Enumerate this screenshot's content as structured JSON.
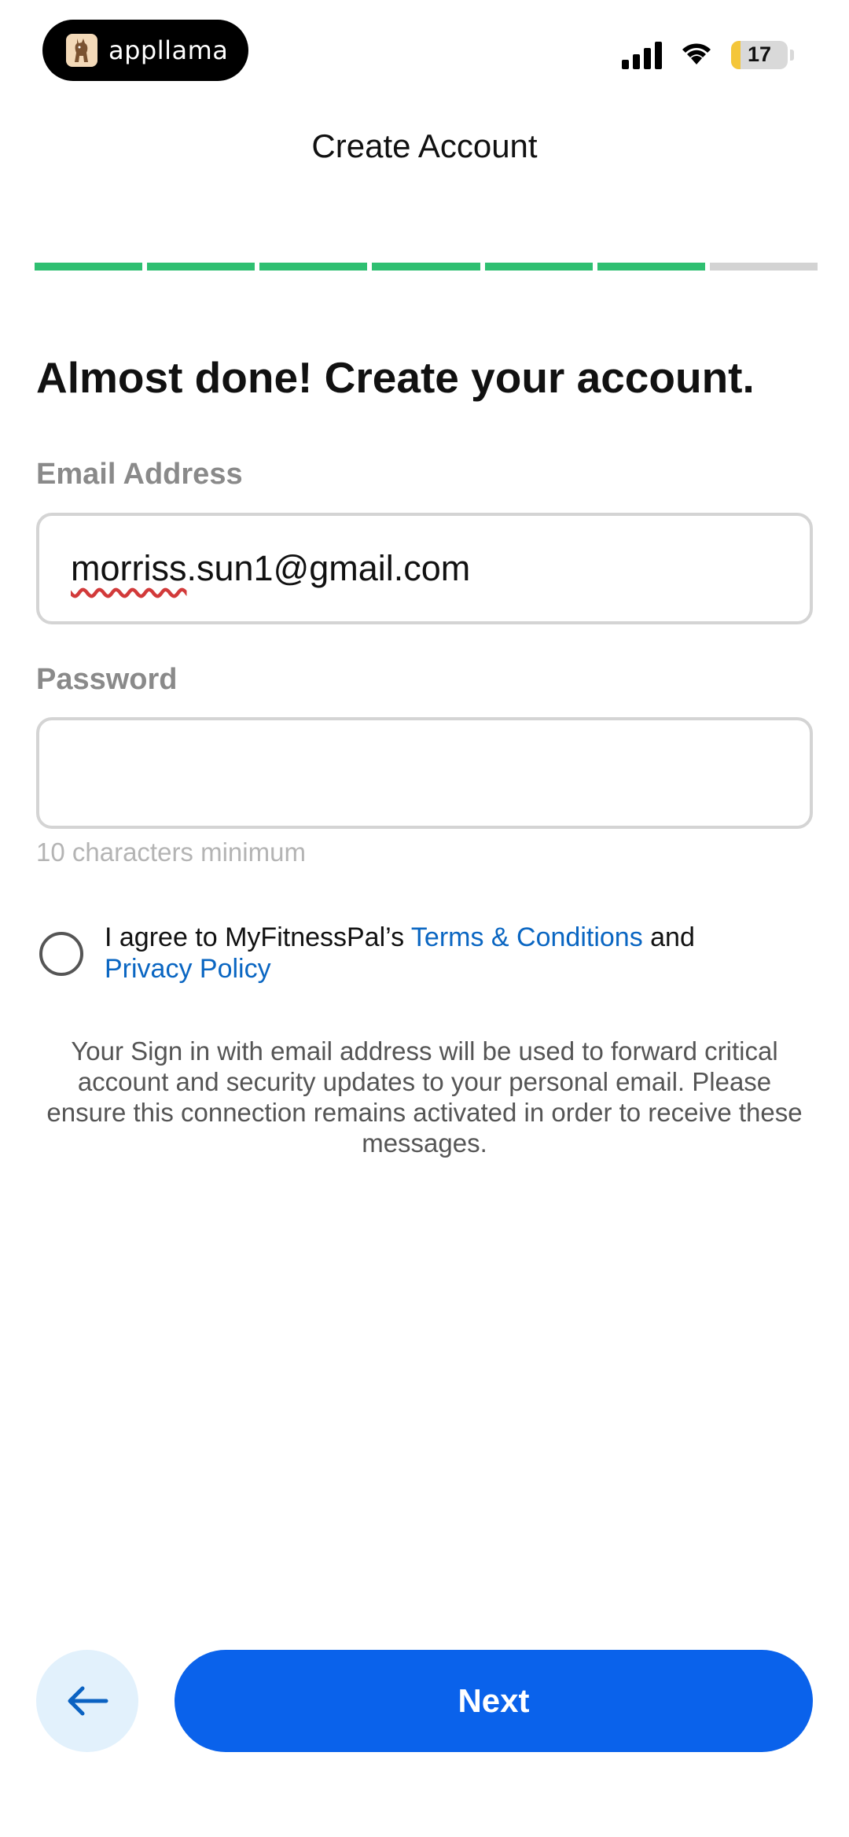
{
  "status_bar": {
    "brand_name": "appllama",
    "battery_level": "17",
    "battery_fraction": 0.17,
    "battery_color": "#f4c63a"
  },
  "header": {
    "title": "Create Account"
  },
  "progress": {
    "completed_steps": 6,
    "total_steps": 7,
    "color_done": "#2fbf71",
    "color_remaining": "#d3d3d3"
  },
  "form": {
    "heading": "Almost done! Create your account.",
    "email": {
      "label": "Email Address",
      "value_misspelled_part": "morriss",
      "value_rest": ".sun1@gmail.com"
    },
    "password": {
      "label": "Password",
      "value": "",
      "helper": "10 characters minimum"
    },
    "agreement": {
      "checked": false,
      "text_before": "I agree to MyFitnessPal’s ",
      "terms_link": "Terms & Conditions",
      "text_middle": " and",
      "privacy_link": "Privacy Policy"
    },
    "info": "Your Sign in with email address will be used to forward critical account and security updates to your personal email. Please ensure this connection remains activated in order to receive these messages."
  },
  "actions": {
    "back_icon": "arrow-left-icon",
    "next_label": "Next",
    "accent_color": "#0a62eb"
  }
}
